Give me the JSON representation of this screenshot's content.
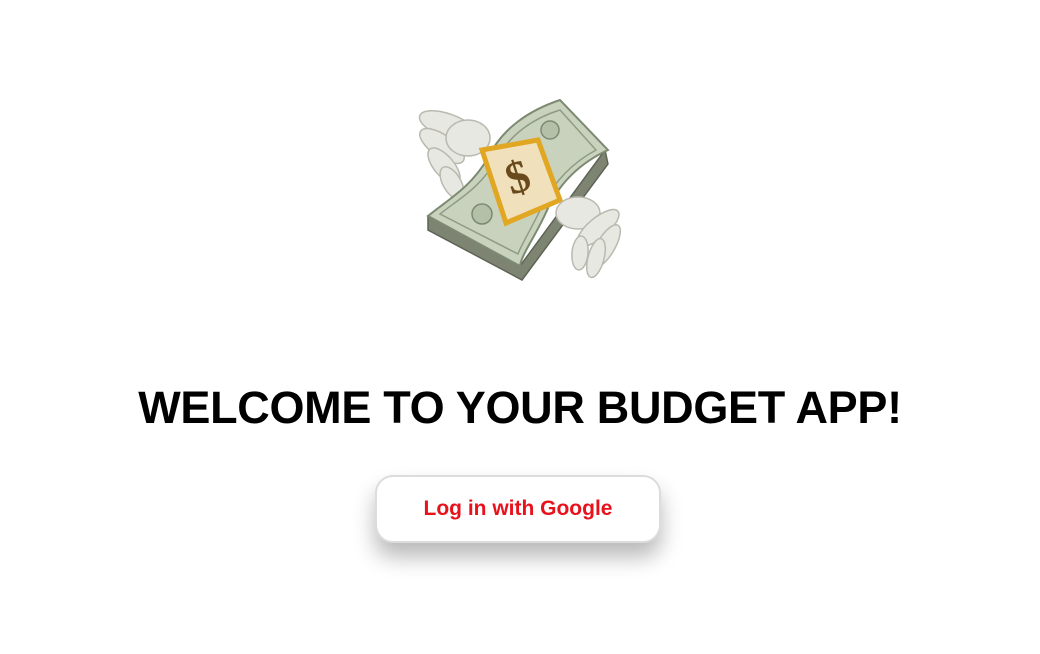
{
  "hero": {
    "icon": "money-with-wings-icon",
    "bill_symbol": "$"
  },
  "welcome": {
    "title": "WELCOME TO YOUR BUDGET APP!"
  },
  "login": {
    "button_label": "Log in with Google",
    "label_color": "#e8121d"
  }
}
